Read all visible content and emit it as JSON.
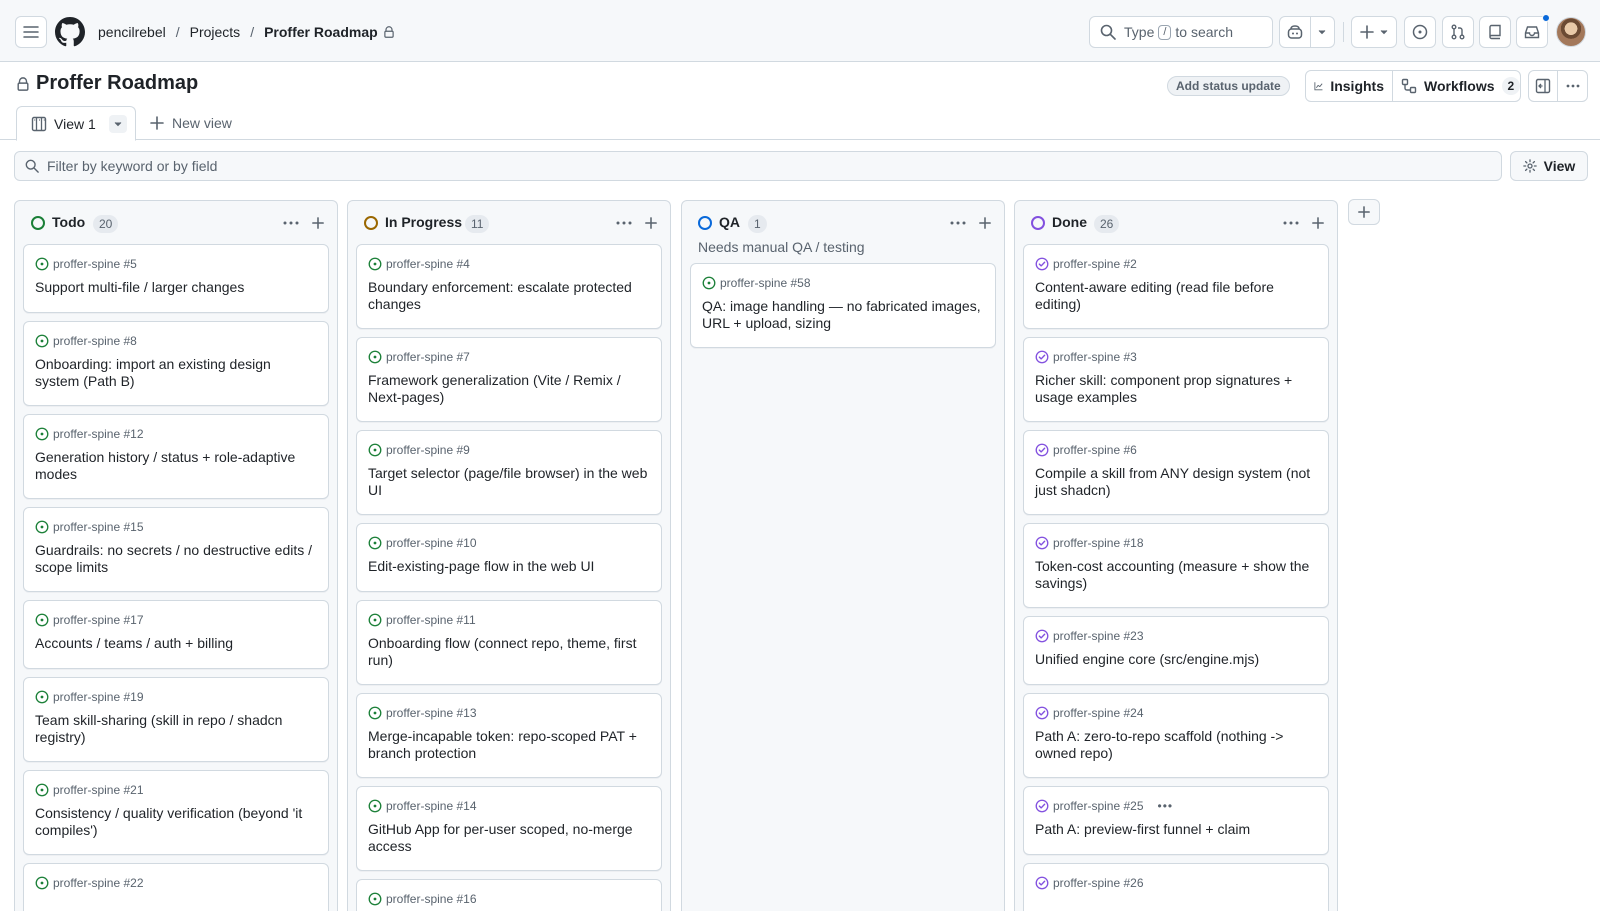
{
  "header": {
    "breadcrumb": {
      "owner": "pencilrebel",
      "projects": "Projects",
      "project": "Proffer Roadmap"
    },
    "search": {
      "prefix": "Type",
      "key": "/",
      "suffix": "to search"
    }
  },
  "page": {
    "title": "Proffer Roadmap",
    "status_update": "Add status update",
    "insights": "Insights",
    "workflows": "Workflows",
    "workflows_count": "2"
  },
  "tabs": {
    "active": "View 1",
    "new_view": "New view"
  },
  "filter": {
    "placeholder": "Filter by keyword or by field"
  },
  "view_button": "View",
  "colors": {
    "todo": "#1a7f37",
    "in_progress": "#9a6700",
    "qa": "#0969da",
    "done": "#8250df"
  },
  "board": {
    "columns": [
      {
        "name": "Todo",
        "count": "20",
        "description": "",
        "cards": [
          {
            "ref": "proffer-spine #5",
            "title": "Support multi-file / larger changes"
          },
          {
            "ref": "proffer-spine #8",
            "title": "Onboarding: import an existing design system (Path B)"
          },
          {
            "ref": "proffer-spine #12",
            "title": "Generation history / status + role-adaptive modes"
          },
          {
            "ref": "proffer-spine #15",
            "title": "Guardrails: no secrets / no destructive edits / scope limits"
          },
          {
            "ref": "proffer-spine #17",
            "title": "Accounts / teams / auth + billing"
          },
          {
            "ref": "proffer-spine #19",
            "title": "Team skill-sharing (skill in repo / shadcn registry)"
          },
          {
            "ref": "proffer-spine #21",
            "title": "Consistency / quality verification (beyond 'it compiles')"
          },
          {
            "ref": "proffer-spine #22",
            "title": ""
          }
        ]
      },
      {
        "name": "In Progress",
        "count": "11",
        "description": "",
        "cards": [
          {
            "ref": "proffer-spine #4",
            "title": "Boundary enforcement: escalate protected changes"
          },
          {
            "ref": "proffer-spine #7",
            "title": "Framework generalization (Vite / Remix / Next-pages)"
          },
          {
            "ref": "proffer-spine #9",
            "title": "Target selector (page/file browser) in the web UI"
          },
          {
            "ref": "proffer-spine #10",
            "title": "Edit-existing-page flow in the web UI"
          },
          {
            "ref": "proffer-spine #11",
            "title": "Onboarding flow (connect repo, theme, first run)"
          },
          {
            "ref": "proffer-spine #13",
            "title": "Merge-incapable token: repo-scoped PAT + branch protection"
          },
          {
            "ref": "proffer-spine #14",
            "title": "GitHub App for per-user scoped, no-merge access"
          },
          {
            "ref": "proffer-spine #16",
            "title": ""
          }
        ]
      },
      {
        "name": "QA",
        "count": "1",
        "description": "Needs manual QA / testing",
        "cards": [
          {
            "ref": "proffer-spine #58",
            "title": "QA: image handling — no fabricated images, URL + upload, sizing"
          }
        ]
      },
      {
        "name": "Done",
        "count": "26",
        "description": "",
        "cards": [
          {
            "ref": "proffer-spine #2",
            "title": "Content-aware editing (read file before editing)"
          },
          {
            "ref": "proffer-spine #3",
            "title": "Richer skill: component prop signatures + usage examples"
          },
          {
            "ref": "proffer-spine #6",
            "title": "Compile a skill from ANY design system (not just shadcn)"
          },
          {
            "ref": "proffer-spine #18",
            "title": "Token-cost accounting (measure + show the savings)"
          },
          {
            "ref": "proffer-spine #23",
            "title": "Unified engine core (src/engine.mjs)"
          },
          {
            "ref": "proffer-spine #24",
            "title": "Path A: zero-to-repo scaffold (nothing -> owned repo)"
          },
          {
            "ref": "proffer-spine #25",
            "title": "Path A: preview-first funnel + claim",
            "menu": "•••"
          },
          {
            "ref": "proffer-spine #26",
            "title": ""
          }
        ]
      }
    ]
  }
}
